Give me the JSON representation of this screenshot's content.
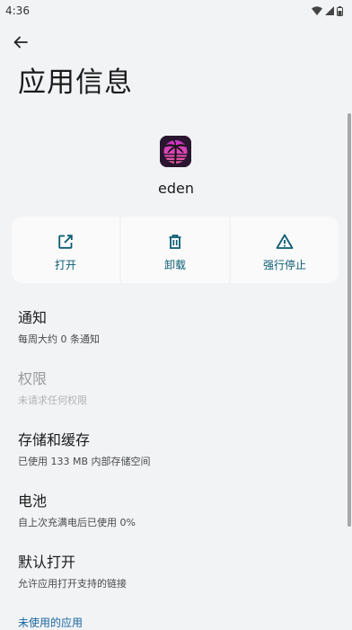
{
  "status_bar": {
    "time": "4:36",
    "icons": [
      "wifi-icon",
      "signal-icon",
      "battery-icon"
    ]
  },
  "header": {
    "title": "应用信息",
    "back_icon": "arrow-left-icon"
  },
  "app": {
    "name": "eden",
    "icon": "palm-tree-app-icon"
  },
  "actions": [
    {
      "label": "打开",
      "icon": "open-external-icon"
    },
    {
      "label": "卸载",
      "icon": "trash-icon"
    },
    {
      "label": "强行停止",
      "icon": "warning-icon"
    }
  ],
  "items": [
    {
      "title": "通知",
      "subtitle": "每周大约 0 条通知",
      "enabled": true
    },
    {
      "title": "权限",
      "subtitle": "未请求任何权限",
      "enabled": false
    },
    {
      "title": "存储和缓存",
      "subtitle": "已使用 133 MB 内部存储空间",
      "enabled": true
    },
    {
      "title": "电池",
      "subtitle": "自上次充满电后已使用 0%",
      "enabled": true
    },
    {
      "title": "默认打开",
      "subtitle": "允许应用打开支持的链接",
      "enabled": true
    }
  ],
  "section": {
    "label": "未使用的应用"
  },
  "colors": {
    "accent": "#0b5c73",
    "link": "#1766a0",
    "background": "#f2f3f5"
  }
}
